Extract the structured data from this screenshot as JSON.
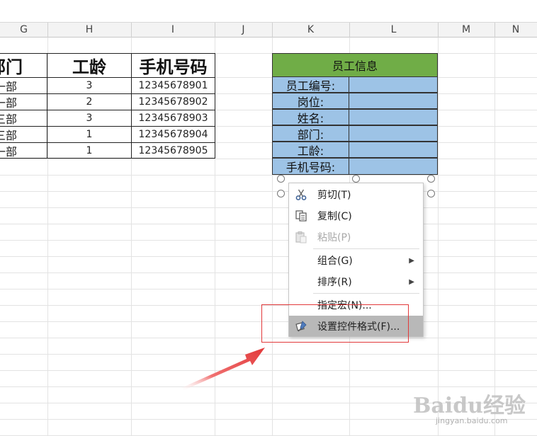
{
  "columns": [
    "G",
    "H",
    "I",
    "J",
    "K",
    "L",
    "M",
    "N"
  ],
  "left_table": {
    "headers": [
      "部门",
      "工龄",
      "手机号码"
    ],
    "rows": [
      [
        "一部",
        "3",
        "12345678901"
      ],
      [
        "一部",
        "2",
        "12345678902"
      ],
      [
        "三部",
        "3",
        "12345678903"
      ],
      [
        "三部",
        "1",
        "12345678904"
      ],
      [
        "一部",
        "1",
        "12345678905"
      ]
    ]
  },
  "info_panel": {
    "title": "员工信息",
    "labels": [
      "员工编号:",
      "岗位:",
      "姓名:",
      "部门:",
      "工龄:",
      "手机号码:"
    ]
  },
  "context_menu": {
    "items": [
      {
        "label": "剪切(T)",
        "icon": "scissors-icon",
        "enabled": true,
        "submenu": false,
        "highlight": false
      },
      {
        "label": "复制(C)",
        "icon": "copy-icon",
        "enabled": true,
        "submenu": false,
        "highlight": false
      },
      {
        "label": "粘贴(P)",
        "icon": "paste-icon",
        "enabled": false,
        "submenu": false,
        "highlight": false
      },
      {
        "label": "组合(G)",
        "icon": "",
        "enabled": true,
        "submenu": true,
        "highlight": false
      },
      {
        "label": "排序(R)",
        "icon": "",
        "enabled": true,
        "submenu": true,
        "highlight": false
      },
      {
        "label": "指定宏(N)...",
        "icon": "",
        "enabled": true,
        "submenu": false,
        "highlight": false
      },
      {
        "label": "设置控件格式(F)...",
        "icon": "format-control-icon",
        "enabled": true,
        "submenu": false,
        "highlight": true
      }
    ]
  },
  "watermark": {
    "brand": "Baidu经验",
    "url": "jingyan.baidu.com"
  },
  "colors": {
    "title_green": "#70ad47",
    "label_blue": "#9dc3e6",
    "annotation_red": "#e2393a",
    "menu_highlight": "#b8b8b8"
  }
}
